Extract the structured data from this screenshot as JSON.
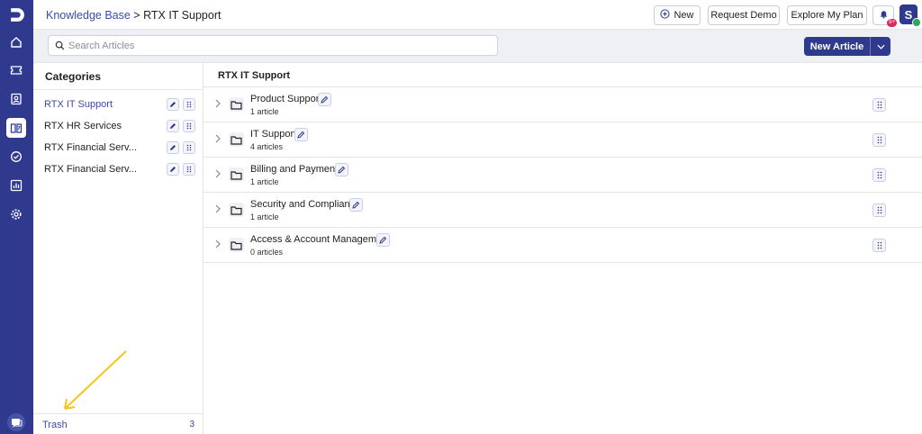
{
  "breadcrumb": {
    "root": "Knowledge Base",
    "separator": " > ",
    "current": "RTX IT Support"
  },
  "topbar": {
    "new_label": "New",
    "request_demo_label": "Request Demo",
    "explore_plan_label": "Explore My Plan",
    "notification_badge": "9+",
    "avatar_initial": "S"
  },
  "search": {
    "placeholder": "Search Articles",
    "value": ""
  },
  "new_article_label": "New Article",
  "sidebar": {
    "title": "Categories",
    "items": [
      {
        "label": "RTX IT Support",
        "active": true
      },
      {
        "label": "RTX HR Services",
        "active": false
      },
      {
        "label": "RTX Financial Serv...",
        "active": false
      },
      {
        "label": "RTX Financial Serv...",
        "active": false
      }
    ],
    "trash_label": "Trash",
    "trash_count": "3"
  },
  "main": {
    "title": "RTX IT Support",
    "folders": [
      {
        "name": "Product Support",
        "count": "1 article"
      },
      {
        "name": "IT Support",
        "count": "4 articles"
      },
      {
        "name": "Billing and Payments",
        "count": "1 article"
      },
      {
        "name": "Security and Compliance",
        "count": "1 article"
      },
      {
        "name": "Access & Account Management",
        "count": "0 articles"
      }
    ]
  },
  "rail_icons": [
    "logo-icon",
    "home-icon",
    "ticket-icon",
    "contacts-icon",
    "knowledge-base-icon",
    "tasks-icon",
    "reports-icon",
    "settings-icon",
    "chat-icon"
  ],
  "colors": {
    "brand": "#2f3a8f",
    "link": "#3a4aa8",
    "annotation_arrow": "#f5c518",
    "badge": "#e0245e",
    "online": "#29a85b"
  }
}
